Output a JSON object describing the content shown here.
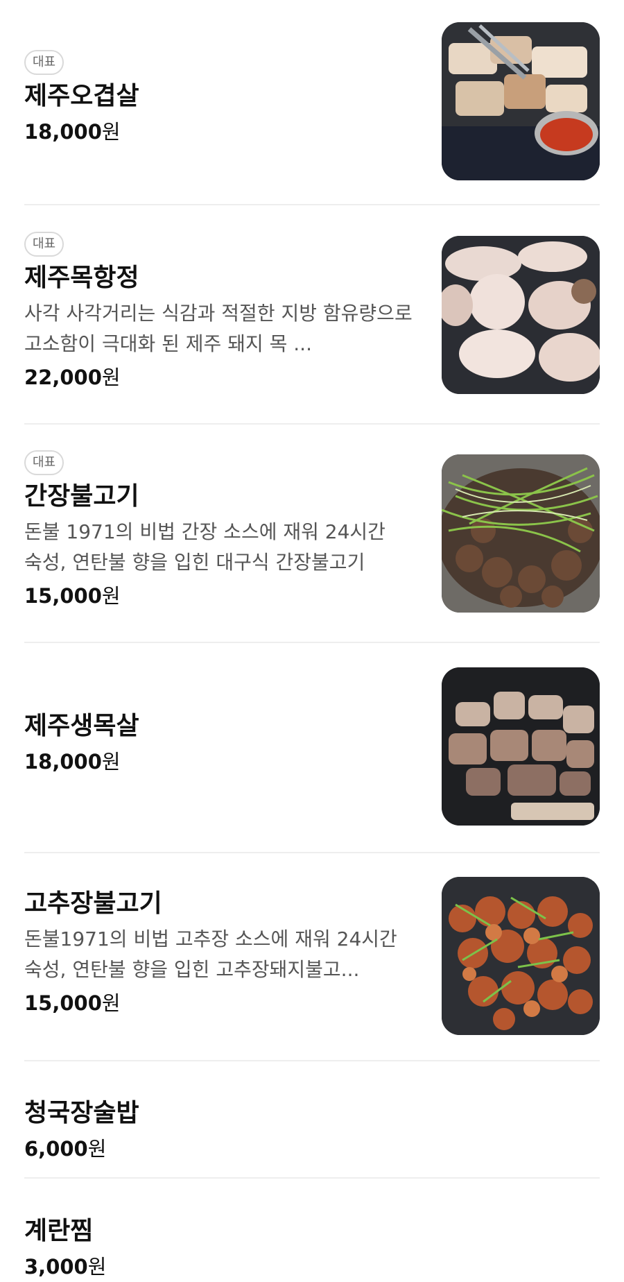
{
  "menu": {
    "items": [
      {
        "badge": "대표",
        "name": "제주오겹살",
        "description": "",
        "price_num": "18,000",
        "price_unit": "원",
        "photo": "grilled-pork-belly-photo"
      },
      {
        "badge": "대표",
        "name": "제주목항정",
        "description": "사각 사각거리는 식감과 적절한 지방 함유량으로 고소함이 극대화 된 제주 돼지 목 ...",
        "price_num": "22,000",
        "price_unit": "원",
        "photo": "grilled-pork-neck-photo"
      },
      {
        "badge": "대표",
        "name": "간장불고기",
        "description": "돈불 1971의 비법 간장 소스에 재워 24시간 숙성, 연탄불 향을 입힌 대구식 간장불고기",
        "price_num": "15,000",
        "price_unit": "원",
        "photo": "soy-bulgogi-photo"
      },
      {
        "badge": "",
        "name": "제주생목살",
        "description": "",
        "price_num": "18,000",
        "price_unit": "원",
        "photo": "pork-collar-photo"
      },
      {
        "badge": "",
        "name": "고추장불고기",
        "description": "돈불1971의 비법 고추장 소스에 재워 24시간 숙성, 연탄불 향을 입힌 고추장돼지불고...",
        "price_num": "15,000",
        "price_unit": "원",
        "photo": "gochujang-bulgogi-photo"
      },
      {
        "badge": "",
        "name": "청국장술밥",
        "description": "",
        "price_num": "6,000",
        "price_unit": "원",
        "photo": ""
      },
      {
        "badge": "",
        "name": "계란찜",
        "description": "",
        "price_num": "3,000",
        "price_unit": "원",
        "photo": ""
      }
    ]
  },
  "colors": {
    "text": "#111111",
    "description": "#555555",
    "badge_border": "#d9d9d9",
    "divider": "#eeeeee"
  }
}
